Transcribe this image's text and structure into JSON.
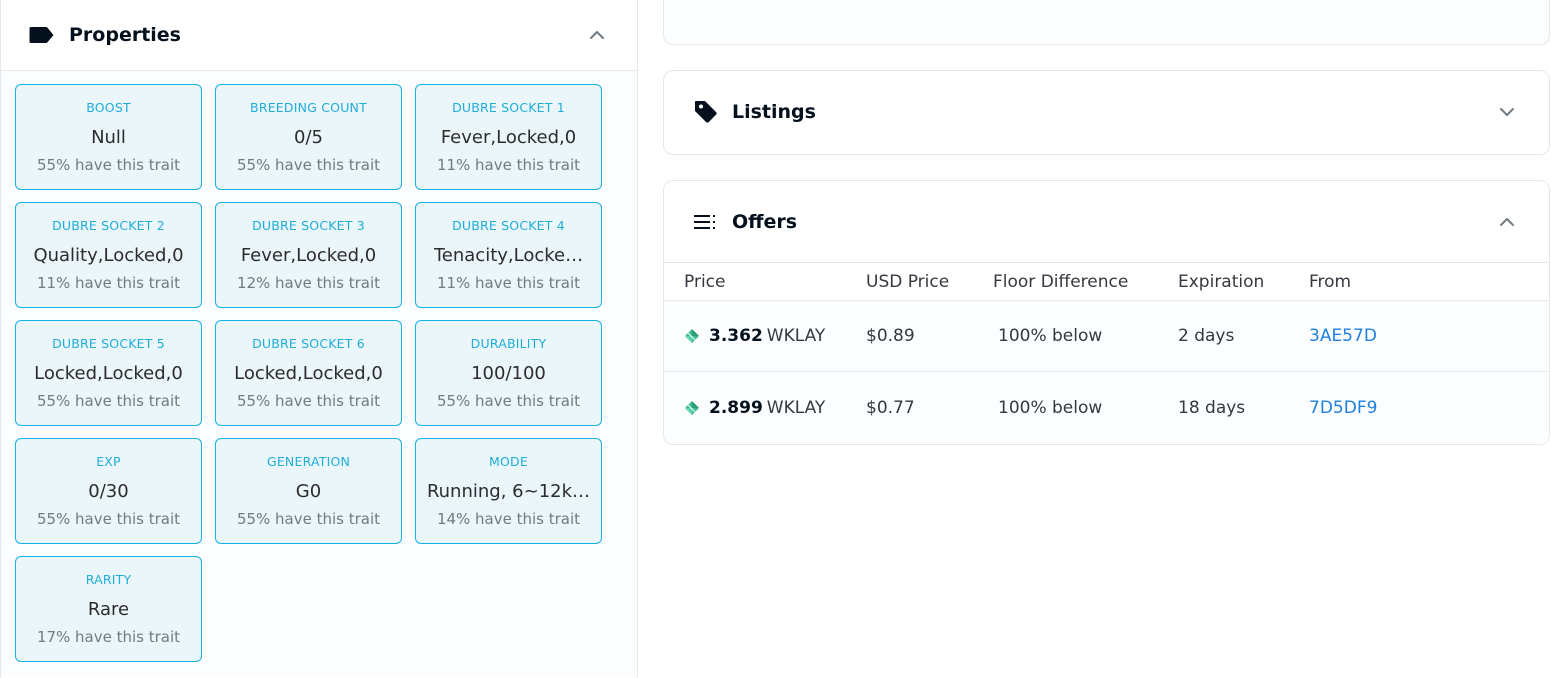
{
  "properties": {
    "title": "Properties",
    "traits": [
      {
        "type": "BOOST",
        "value": "Null",
        "rarity": "55% have this trait"
      },
      {
        "type": "BREEDING COUNT",
        "value": "0/5",
        "rarity": "55% have this trait"
      },
      {
        "type": "DUBRE SOCKET 1",
        "value": "Fever,Locked,0",
        "rarity": "11% have this trait"
      },
      {
        "type": "DUBRE SOCKET 2",
        "value": "Quality,Locked,0",
        "rarity": "11% have this trait"
      },
      {
        "type": "DUBRE SOCKET 3",
        "value": "Fever,Locked,0",
        "rarity": "12% have this trait"
      },
      {
        "type": "DUBRE SOCKET 4",
        "value": "Tenacity,Locke…",
        "rarity": "11% have this trait"
      },
      {
        "type": "DUBRE SOCKET 5",
        "value": "Locked,Locked,0",
        "rarity": "55% have this trait"
      },
      {
        "type": "DUBRE SOCKET 6",
        "value": "Locked,Locked,0",
        "rarity": "55% have this trait"
      },
      {
        "type": "DURABILITY",
        "value": "100/100",
        "rarity": "55% have this trait"
      },
      {
        "type": "EXP",
        "value": "0/30",
        "rarity": "55% have this trait"
      },
      {
        "type": "GENERATION",
        "value": "G0",
        "rarity": "55% have this trait"
      },
      {
        "type": "MODE",
        "value": "Running, 6~12k…",
        "rarity": "14% have this trait"
      },
      {
        "type": "RARITY",
        "value": "Rare",
        "rarity": "17% have this trait"
      }
    ]
  },
  "listings": {
    "title": "Listings"
  },
  "offers": {
    "title": "Offers",
    "columns": {
      "price": "Price",
      "usd": "USD Price",
      "floor": "Floor Difference",
      "expiration": "Expiration",
      "from": "From"
    },
    "rows": [
      {
        "amount": "3.362",
        "unit": "WKLAY",
        "usd": "$0.89",
        "floor": "100% below",
        "expiration": "2 days",
        "from": "3AE57D"
      },
      {
        "amount": "2.899",
        "unit": "WKLAY",
        "usd": "$0.77",
        "floor": "100% below",
        "expiration": "18 days",
        "from": "7D5DF9"
      }
    ]
  },
  "colors": {
    "accent": "#15b2e5",
    "trait_bg": "#ebf6fb",
    "link": "#2081e2",
    "token_green": "#3dbd8e"
  },
  "icons": {
    "properties": "label-tag-icon",
    "listings": "price-tag-icon",
    "offers": "list-icon",
    "token": "wklay-token-icon"
  }
}
